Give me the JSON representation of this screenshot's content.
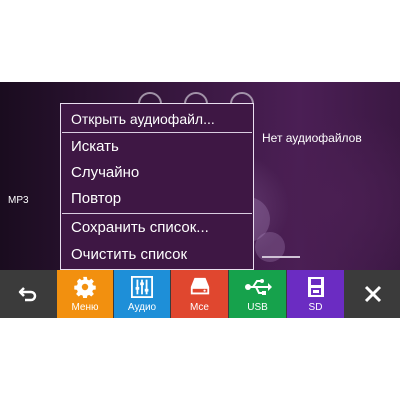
{
  "header": {
    "no_files_text": "Нет аудиофайлов"
  },
  "sidebar": {
    "format_label": "MP3"
  },
  "context_menu": {
    "items": [
      {
        "label": "Открыть аудиофайл..."
      },
      {
        "label": "Искать"
      },
      {
        "label": "Случайно"
      },
      {
        "label": "Повтор"
      },
      {
        "label": "Сохранить список..."
      },
      {
        "label": "Очистить список"
      }
    ]
  },
  "toolbar": {
    "back_icon": "back-icon",
    "buttons": [
      {
        "label": "Меню",
        "icon": "gear-icon",
        "color": "#f2900f"
      },
      {
        "label": "Аудио",
        "icon": "equalizer-icon",
        "color": "#1e8fd8"
      },
      {
        "label": "Мсе",
        "icon": "storage-icon",
        "color": "#e0472f"
      },
      {
        "label": "USB",
        "icon": "usb-icon",
        "color": "#16a24c"
      },
      {
        "label": "SD",
        "icon": "sd-card-icon",
        "color": "#6b2cc2"
      }
    ],
    "close_icon": "close-icon"
  },
  "colors": {
    "background": "#3b1843",
    "toolbar": "#3b3b3b",
    "menu": "#3e1744"
  }
}
